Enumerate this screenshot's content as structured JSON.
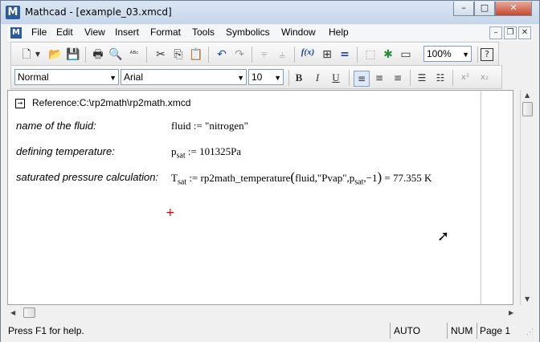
{
  "window": {
    "title": "Mathcad - [example_03.xmcd]",
    "app_icon": "M"
  },
  "window_controls": {
    "minimize": "–",
    "maximize": "□",
    "close": "✕"
  },
  "mdi_controls": {
    "minimize": "–",
    "restore": "❐",
    "close": "✕"
  },
  "menu": {
    "doc_icon": "M",
    "items": [
      "File",
      "Edit",
      "View",
      "Insert",
      "Format",
      "Tools",
      "Symbolics",
      "Window",
      "Help"
    ]
  },
  "toolbar": {
    "icons": [
      "new-icon",
      "open-icon",
      "save-icon",
      "print-icon",
      "print-preview-icon",
      "spellcheck-icon",
      "cut-icon",
      "copy-icon",
      "paste-icon",
      "undo-icon",
      "redo-icon",
      "align-top-icon",
      "align-down-icon",
      "insert-function-icon",
      "insert-unit-icon",
      "calculate-icon",
      "component-icon",
      "resource-icon",
      "window-icon",
      "help-icon"
    ],
    "symbols": {
      "new-icon": "🗋",
      "open-icon": "📂",
      "save-icon": "💾",
      "print-icon": "🖶",
      "print-preview-icon": "🔍",
      "spellcheck-icon": "ᴬᴮᶜ",
      "cut-icon": "✂",
      "copy-icon": "⎘",
      "paste-icon": "📋",
      "undo-icon": "↶",
      "redo-icon": "↷",
      "align-top-icon": "⫧",
      "align-down-icon": "⫨",
      "insert-function-icon": "f(x)",
      "insert-unit-icon": "⊞",
      "calculate-icon": "=",
      "component-icon": "⬚",
      "resource-icon": "✱",
      "window-icon": "▭",
      "help-icon": "?"
    },
    "zoom": "100%"
  },
  "formatting": {
    "style": "Normal",
    "font": "Arial",
    "size": "10",
    "bold": "B",
    "italic": "I",
    "underline": "U",
    "superscript": "x²",
    "subscript": "x₂"
  },
  "document": {
    "reference": "Reference:C:\\rp2math\\rp2math.xmcd",
    "rows": [
      {
        "label": "name of the fluid:"
      },
      {
        "label": "defining temperature:"
      },
      {
        "label": "saturated pressure calculation:"
      }
    ],
    "eq1": {
      "var": "fluid",
      "assign": ":=",
      "value": "\"nitrogen\""
    },
    "eq2": {
      "var": "p",
      "sub": "sat",
      "assign": ":=",
      "value": "101325Pa"
    },
    "eq3": {
      "var": "T",
      "sub": "sat",
      "assign": ":=",
      "func": "rp2math_temperature",
      "arg1": "fluid",
      "comma": ",",
      "arg2": "\"Pvap\"",
      "arg3": "p",
      "arg3sub": "sat",
      "arg4": "−1",
      "open": "(",
      "close": ")",
      "eq": "=",
      "result": "77.355",
      "unit": "K"
    },
    "cursor": "+"
  },
  "status": {
    "help": "Press F1 for help.",
    "mode": "AUTO",
    "num": "NUM",
    "page": "Page 1"
  }
}
